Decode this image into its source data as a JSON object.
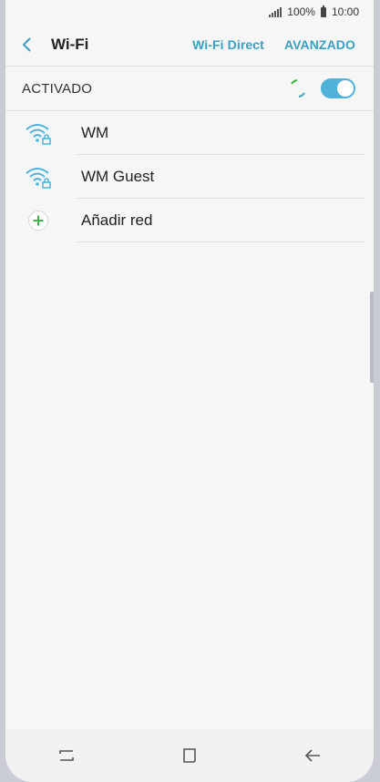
{
  "status_bar": {
    "battery": "100%",
    "time": "10:00"
  },
  "appbar": {
    "title": "Wi-Fi",
    "actions": [
      {
        "label": "Wi-Fi Direct"
      },
      {
        "label": "AVANZADO"
      }
    ]
  },
  "master_switch": {
    "label": "ACTIVADO",
    "state": "on"
  },
  "networks": [
    {
      "name": "WM",
      "icon": "wifi-locked-icon"
    },
    {
      "name": "WM Guest",
      "icon": "wifi-locked-icon"
    }
  ],
  "add_network": {
    "label": "Añadir red",
    "icon": "add-icon"
  },
  "colors": {
    "accent": "#3a9fc3",
    "toggle": "#4fb3d9",
    "add": "#3fb54a"
  }
}
